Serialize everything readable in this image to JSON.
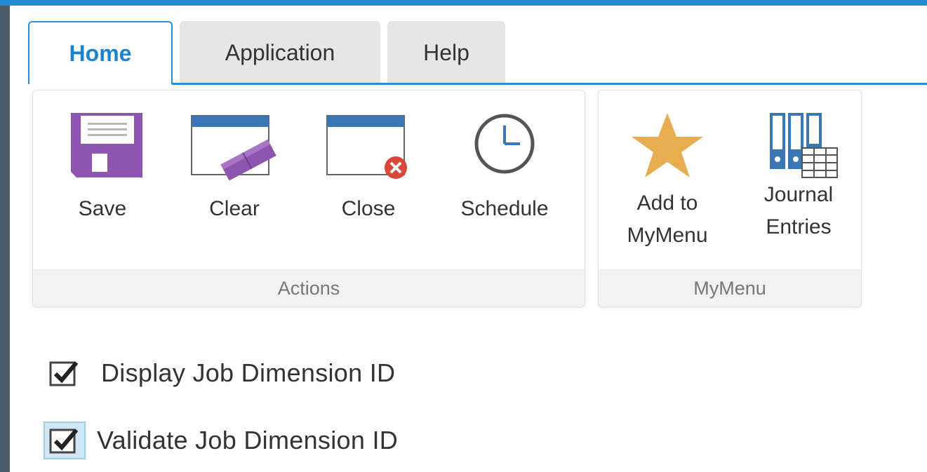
{
  "tabs": [
    {
      "label": "Home",
      "active": true
    },
    {
      "label": "Application",
      "active": false
    },
    {
      "label": "Help",
      "active": false
    }
  ],
  "groups": {
    "actions": {
      "title": "Actions",
      "buttons": [
        {
          "label": "Save",
          "icon": "save-icon"
        },
        {
          "label": "Clear",
          "icon": "clear-icon"
        },
        {
          "label": "Close",
          "icon": "close-icon"
        },
        {
          "label": "Schedule",
          "icon": "schedule-icon"
        }
      ]
    },
    "mymenu": {
      "title": "MyMenu",
      "buttons": [
        {
          "label_line1": "Add to",
          "label_line2": "MyMenu",
          "icon": "star-icon"
        },
        {
          "label_line1": "Journal",
          "label_line2": "Entries",
          "icon": "journal-icon"
        }
      ]
    }
  },
  "checkboxes": [
    {
      "label": "Display Job Dimension ID",
      "checked": true
    },
    {
      "label": "Validate Job Dimension ID",
      "checked": true,
      "focused": true
    }
  ],
  "colors": {
    "accent": "#1b84d0",
    "save_purple": "#8e55b0",
    "window_blue": "#3a78b5",
    "close_red": "#d9463a",
    "star_gold": "#e8ad4f"
  }
}
